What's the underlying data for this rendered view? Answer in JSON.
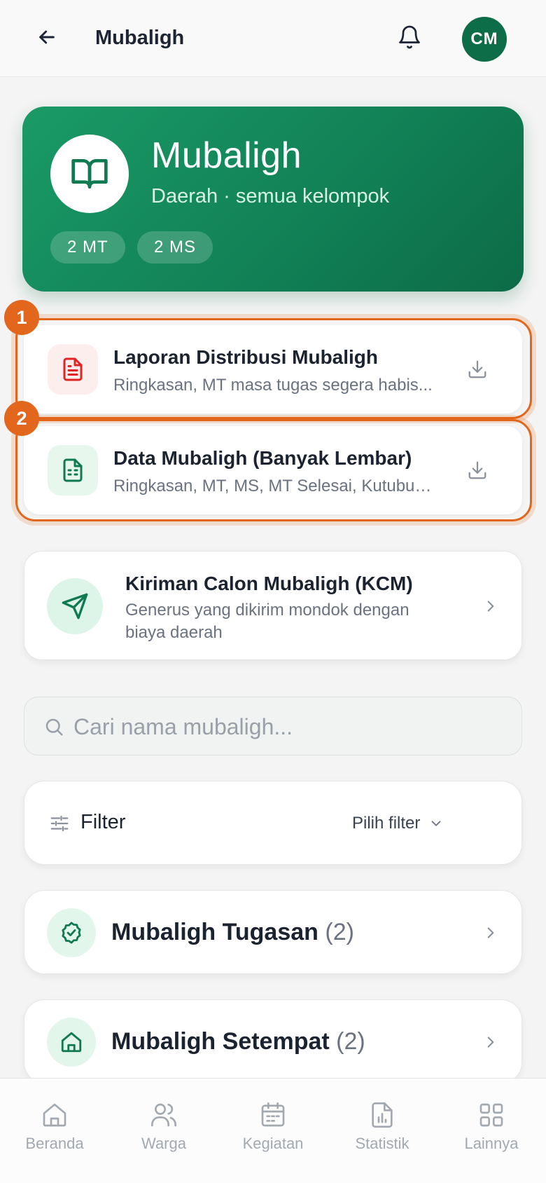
{
  "header": {
    "title": "Mubaligh",
    "avatar_initials": "CM"
  },
  "hero": {
    "title": "Mubaligh",
    "subtitle": "Daerah · semua kelompok",
    "chips": [
      "2 MT",
      "2 MS"
    ]
  },
  "highlights": [
    "1",
    "2"
  ],
  "downloads": [
    {
      "title": "Laporan Distribusi Mubaligh",
      "subtitle": "Ringkasan, MT masa tugas segera habis...",
      "icon": "document-red-icon"
    },
    {
      "title": "Data Mubaligh (Banyak Lembar)",
      "subtitle": "Ringkasan, MT, MS, MT Selesai, Kutubus...",
      "icon": "spreadsheet-green-icon"
    }
  ],
  "kcm": {
    "title": "Kiriman Calon Mubaligh (KCM)",
    "description": "Generus yang dikirim mondok dengan biaya daerah"
  },
  "search": {
    "placeholder": "Cari nama mubaligh...",
    "value": ""
  },
  "filter": {
    "label": "Filter",
    "select_label": "Pilih filter"
  },
  "sections": [
    {
      "label": "Mubaligh Tugasan",
      "count": "(2)",
      "icon": "badge-check-icon"
    },
    {
      "label": "Mubaligh Setempat",
      "count": "(2)",
      "icon": "home-icon"
    }
  ],
  "nav": [
    {
      "label": "Beranda",
      "icon": "home-icon"
    },
    {
      "label": "Warga",
      "icon": "users-icon"
    },
    {
      "label": "Kegiatan",
      "icon": "calendar-icon"
    },
    {
      "label": "Statistik",
      "icon": "chart-file-icon"
    },
    {
      "label": "Lainnya",
      "icon": "grid-icon"
    }
  ],
  "colors": {
    "brand_green": "#128257",
    "highlight_orange": "#e2661c",
    "text_dark": "#1b2230",
    "text_muted": "#6b7280"
  }
}
